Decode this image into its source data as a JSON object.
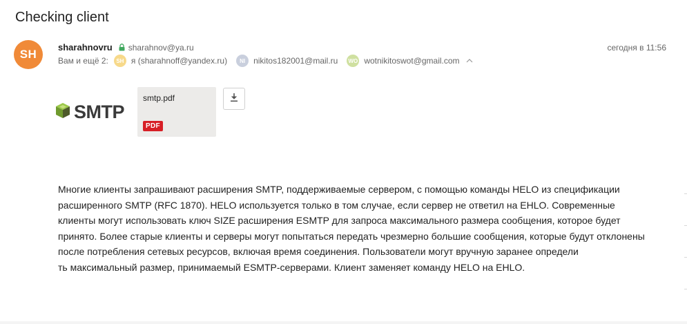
{
  "subject": "Checking client",
  "sender": {
    "avatar_initials": "SH",
    "avatar_color": "#f08a38",
    "name": "sharahnovru",
    "email": "sharahnov@ya.ru",
    "secure_icon": "lock-icon"
  },
  "date": "сегодня в 11:56",
  "recipients": {
    "prefix": "Вам и ещё 2:",
    "list": [
      {
        "initials": "SH",
        "color": "#f7d98a",
        "label": "я (sharahnoff@yandex.ru)"
      },
      {
        "initials": "NI",
        "color": "#c9cfdd",
        "label": "nikitos182001@mail.ru"
      },
      {
        "initials": "WO",
        "color": "#cfe0a0",
        "label": "wotnikitoswot@gmail.com"
      }
    ],
    "toggle_icon": "chevron-up-icon"
  },
  "logo": {
    "text": "SMTP",
    "icon": "cube-logo-icon"
  },
  "attachment": {
    "file_name": "smtp.pdf",
    "badge": "PDF",
    "badge_color": "#d71f26",
    "download_icon": "download-icon"
  },
  "body": {
    "paragraph_1": "Многие клиенты запрашивают расширения SMTP, поддерживаемые сервером, с помощью команды HELO из спецификации расширенного SMTP (RFC 1870). HELO используется только в том случае, если сервер не ответил на EHLO. Современные клиенты могут использовать ключ SIZE расширения ESMTP для запроса максимального размера сообщения, которое будет принято. Более старые клиенты и серверы могут попытаться передать чрезмерно большие сообщения, которые будут отклонены после потребления сетевых ресурсов, включая время соединения. Пользователи могут вручную заранее определи",
    "paragraph_2": " ть максимальный размер, принимаемый ESMTP-серверами. Клиент заменяет команду HELO на EHLO."
  }
}
